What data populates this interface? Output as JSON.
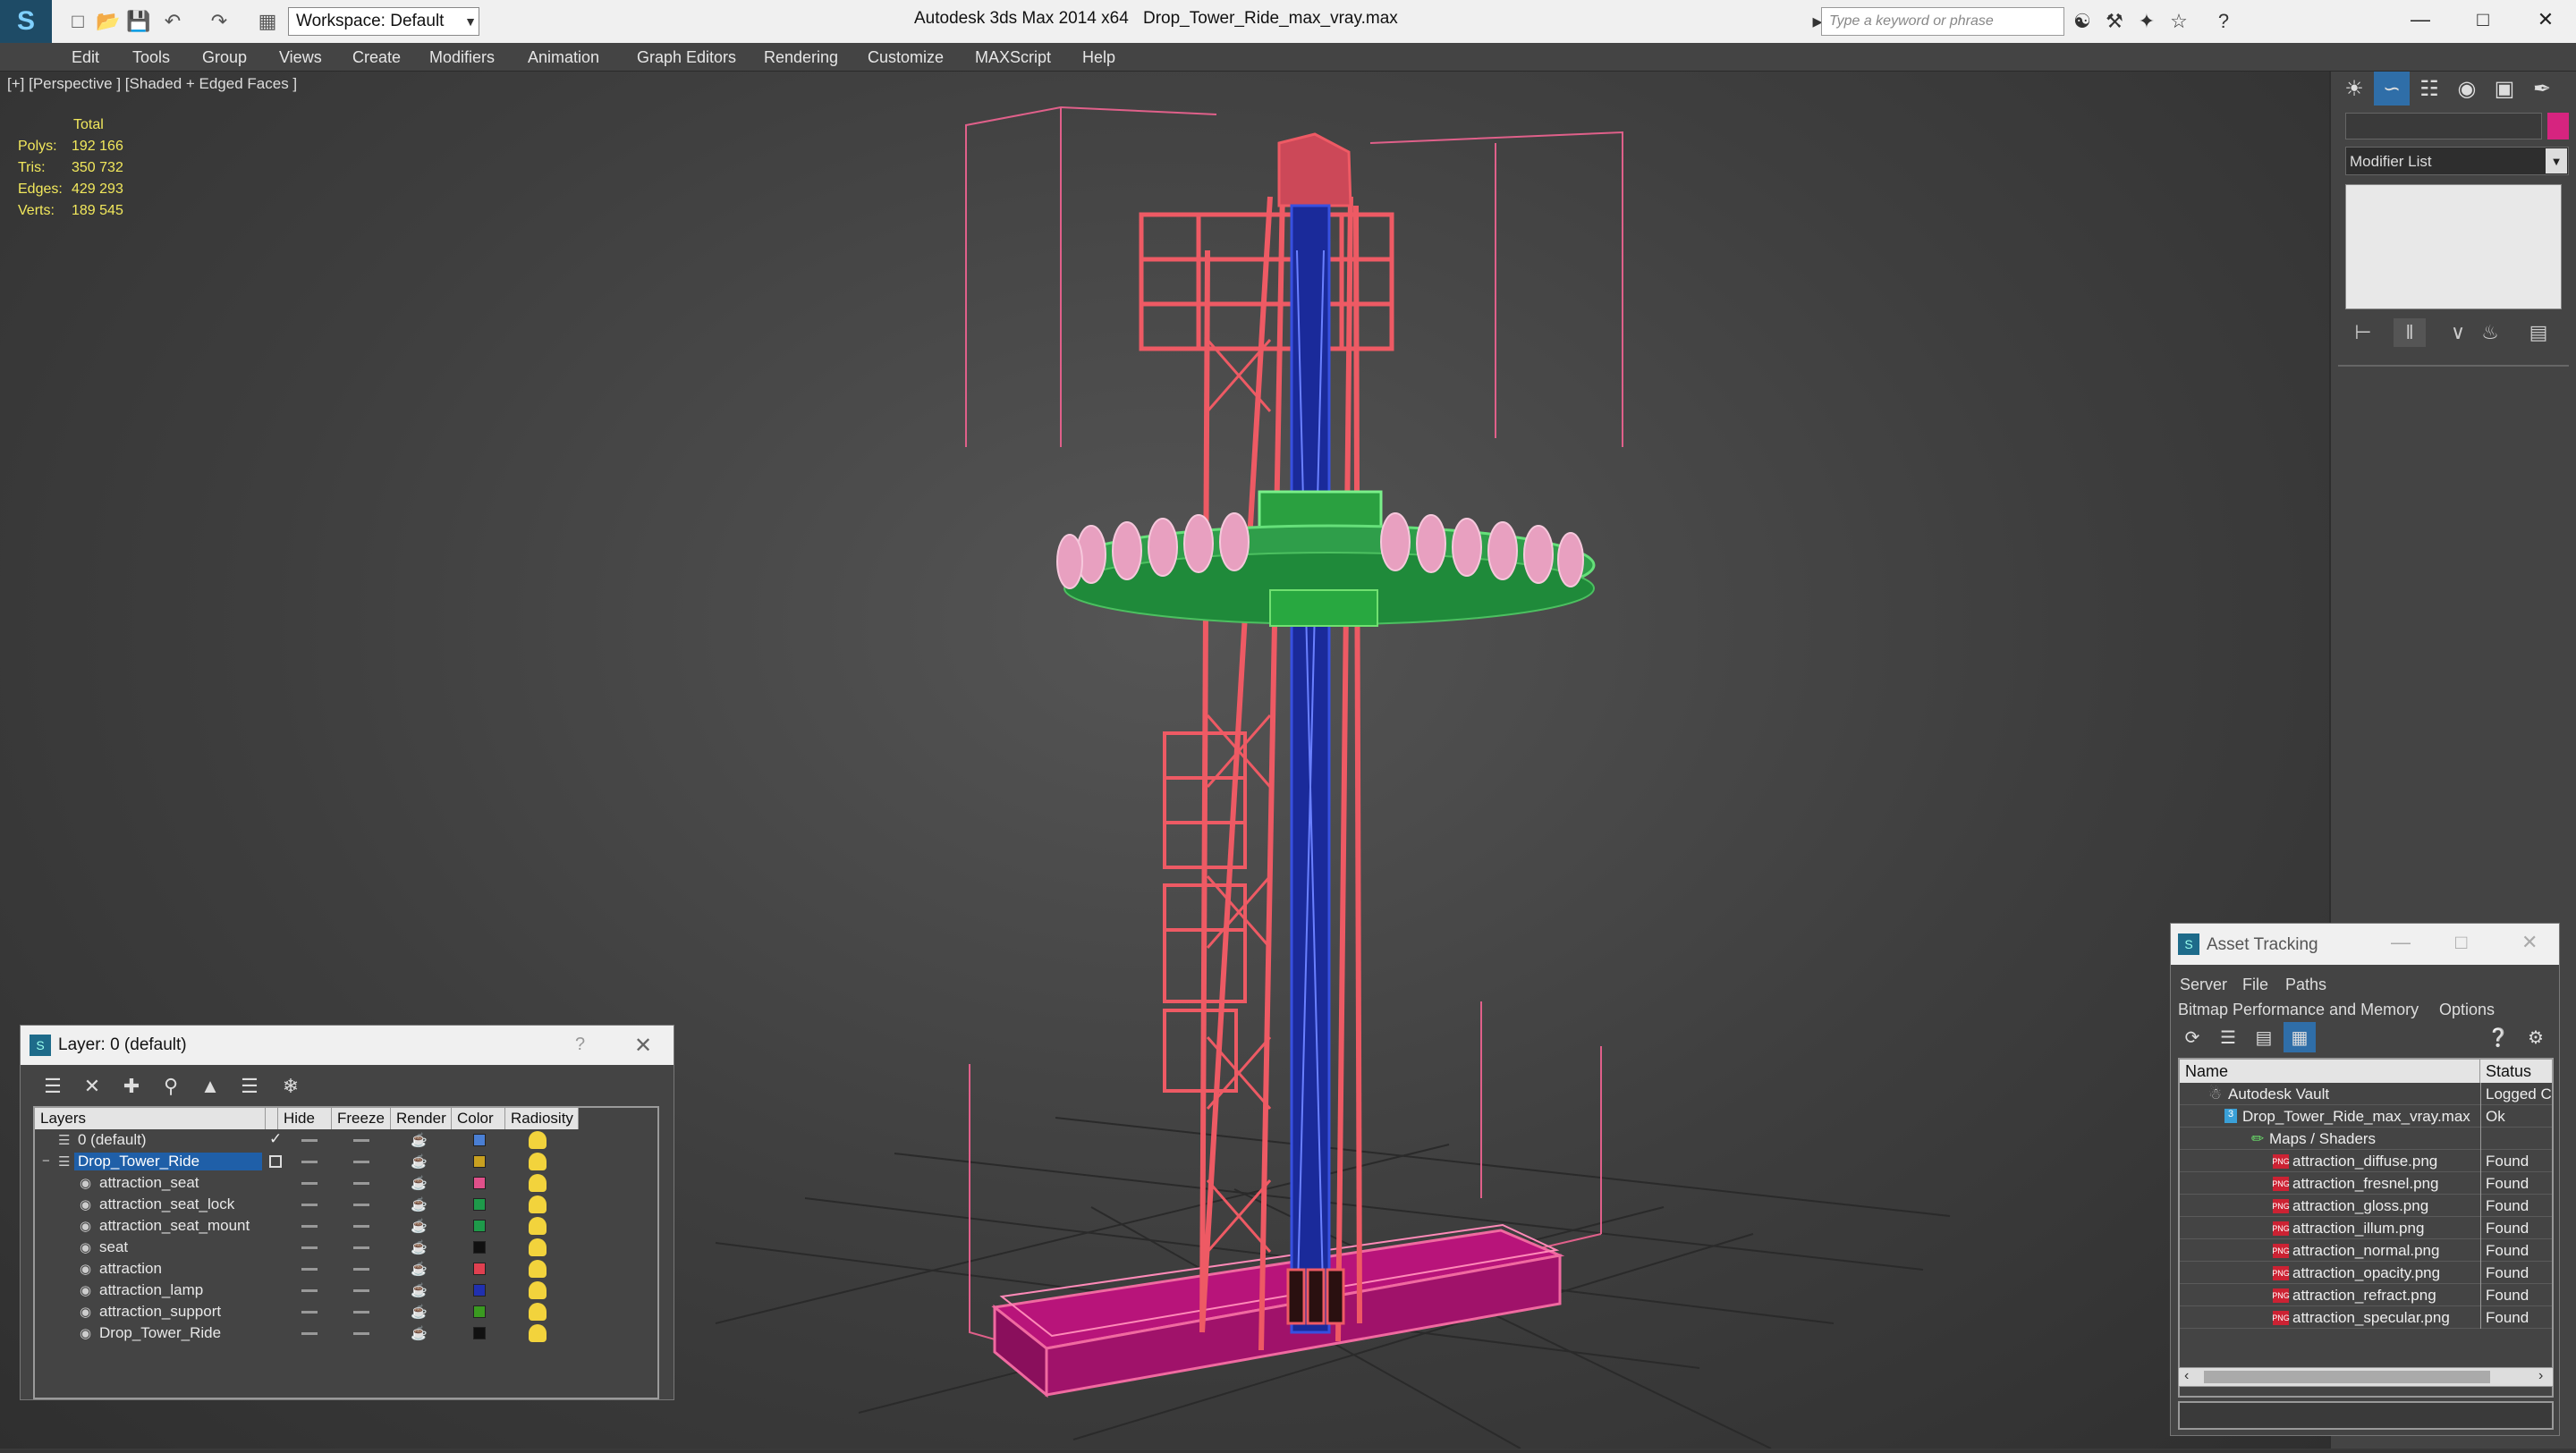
{
  "titlebar": {
    "workspace": "Workspace: Default",
    "app_title": "Autodesk 3ds Max  2014 x64",
    "file_title": "Drop_Tower_Ride_max_vray.max",
    "search_placeholder": "Type a keyword or phrase",
    "help_icon": "?"
  },
  "menu": [
    "Edit",
    "Tools",
    "Group",
    "Views",
    "Create",
    "Modifiers",
    "Animation",
    "Graph Editors",
    "Rendering",
    "Customize",
    "MAXScript",
    "Help"
  ],
  "viewport": {
    "label": "[+] [Perspective ] [Shaded + Edged Faces ]",
    "stats_header": "Total",
    "stats": [
      {
        "label": "Polys:",
        "value": "192 166"
      },
      {
        "label": "Tris:",
        "value": "350 732"
      },
      {
        "label": "Edges:",
        "value": "429 293"
      },
      {
        "label": "Verts:",
        "value": "189 545"
      }
    ]
  },
  "command_panel": {
    "modifier_list": "Modifier List",
    "object_color": "#d6247f"
  },
  "layer_window": {
    "title": "Layer: 0 (default)",
    "help": "?",
    "columns": [
      "Layers",
      "Hide",
      "Freeze",
      "Render",
      "Color",
      "Radiosity"
    ],
    "rows": [
      {
        "name": "0 (default)",
        "color": "#4a7fd4",
        "level": 0,
        "selected": false
      },
      {
        "name": "Drop_Tower_Ride",
        "color": "#c8a020",
        "level": 0,
        "selected": true
      },
      {
        "name": "attraction_seat",
        "color": "#e0508a",
        "level": 1,
        "selected": false
      },
      {
        "name": "attraction_seat_lock",
        "color": "#1e9a4a",
        "level": 1,
        "selected": false
      },
      {
        "name": "attraction_seat_mount",
        "color": "#1e9a4a",
        "level": 1,
        "selected": false
      },
      {
        "name": "seat",
        "color": "#111111",
        "level": 1,
        "selected": false
      },
      {
        "name": "attraction",
        "color": "#e04050",
        "level": 1,
        "selected": false
      },
      {
        "name": "attraction_lamp",
        "color": "#2030b0",
        "level": 1,
        "selected": false
      },
      {
        "name": "attraction_support",
        "color": "#3a9a20",
        "level": 1,
        "selected": false
      },
      {
        "name": "Drop_Tower_Ride",
        "color": "#111111",
        "level": 1,
        "selected": false
      }
    ]
  },
  "asset_window": {
    "title": "Asset Tracking",
    "menu1": [
      "Server",
      "File",
      "Paths"
    ],
    "menu2": [
      "Bitmap Performance and Memory",
      "Options"
    ],
    "columns": [
      "Name",
      "Status"
    ],
    "rows": [
      {
        "name": "Autodesk Vault",
        "status": "Logged C",
        "indent": 0,
        "type": "vault"
      },
      {
        "name": "Drop_Tower_Ride_max_vray.max",
        "status": "Ok",
        "indent": 1,
        "type": "max"
      },
      {
        "name": "Maps / Shaders",
        "status": "",
        "indent": 2,
        "type": "maps"
      },
      {
        "name": "attraction_diffuse.png",
        "status": "Found",
        "indent": 3,
        "type": "png"
      },
      {
        "name": "attraction_fresnel.png",
        "status": "Found",
        "indent": 3,
        "type": "png"
      },
      {
        "name": "attraction_gloss.png",
        "status": "Found",
        "indent": 3,
        "type": "png"
      },
      {
        "name": "attraction_illum.png",
        "status": "Found",
        "indent": 3,
        "type": "png"
      },
      {
        "name": "attraction_normal.png",
        "status": "Found",
        "indent": 3,
        "type": "png"
      },
      {
        "name": "attraction_opacity.png",
        "status": "Found",
        "indent": 3,
        "type": "png"
      },
      {
        "name": "attraction_refract.png",
        "status": "Found",
        "indent": 3,
        "type": "png"
      },
      {
        "name": "attraction_specular.png",
        "status": "Found",
        "indent": 3,
        "type": "png"
      }
    ]
  }
}
